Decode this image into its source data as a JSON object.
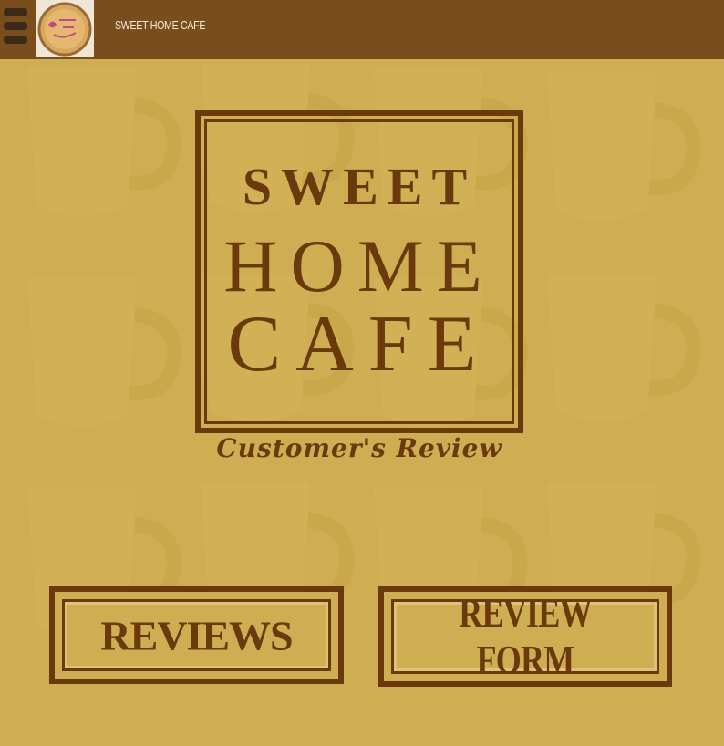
{
  "appbar": {
    "title": "SWEET HOME CAFE",
    "logo_text": "Sweet Home Cafe"
  },
  "brand": {
    "line1": "SWEET",
    "line2": "HOME",
    "line3": "CAFE",
    "subtitle": "Customer's Review"
  },
  "buttons": {
    "reviews_label": "REVIEWS",
    "review_form_label": "REVIEW FORM"
  },
  "colors": {
    "appbar": "#7a4e1c",
    "background": "#cfad52",
    "brand_brown": "#6a3a0c"
  },
  "icons": {
    "menu": "hamburger-menu-icon",
    "logo": "cafe-logo"
  }
}
